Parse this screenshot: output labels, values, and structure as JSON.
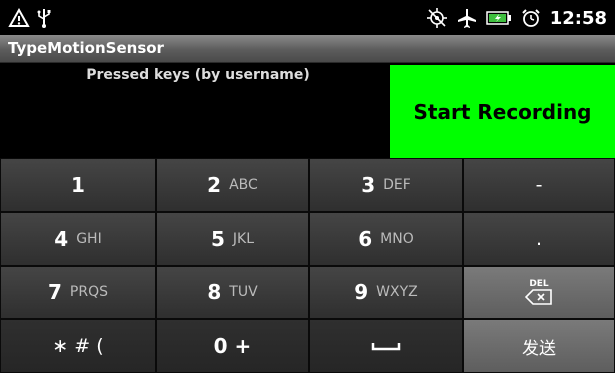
{
  "status_bar": {
    "time": "12:58",
    "left_icons": [
      "warning-icon",
      "usb-icon"
    ],
    "right_icons": [
      "gps-off-icon",
      "airplane-icon",
      "battery-charging-icon",
      "alarm-icon"
    ]
  },
  "app": {
    "title": "TypeMotionSensor"
  },
  "main": {
    "pressed_keys_label": "Pressed keys (by username)",
    "record_button_label": "Start Recording",
    "record_button_color": "#00ff00"
  },
  "keypad": {
    "keys": [
      {
        "main": "1",
        "sub": ""
      },
      {
        "main": "2",
        "sub": "ABC"
      },
      {
        "main": "3",
        "sub": "DEF"
      },
      {
        "main": "-",
        "sub": ""
      },
      {
        "main": "4",
        "sub": "GHI"
      },
      {
        "main": "5",
        "sub": "JKL"
      },
      {
        "main": "6",
        "sub": "MNO"
      },
      {
        "main": ".",
        "sub": ""
      },
      {
        "main": "7",
        "sub": "PRQS"
      },
      {
        "main": "8",
        "sub": "TUV"
      },
      {
        "main": "9",
        "sub": "WXYZ"
      },
      {
        "main": "DEL",
        "sub": ""
      },
      {
        "main": "∗ # (",
        "sub": ""
      },
      {
        "main": "0 +",
        "sub": ""
      },
      {
        "main": "",
        "sub": ""
      },
      {
        "main": "发送",
        "sub": ""
      }
    ]
  }
}
